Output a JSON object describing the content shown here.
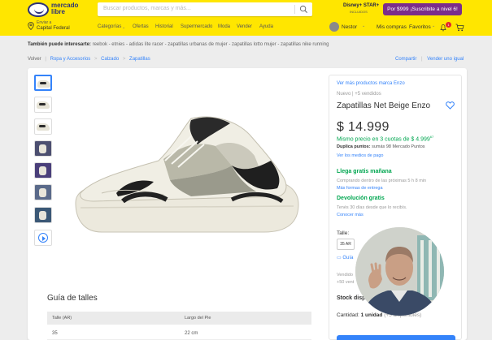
{
  "header": {
    "logo_line1": "mercado",
    "logo_line2": "libre",
    "search_placeholder": "Buscar productos, marcas y más...",
    "promo_brand": "Disney+ STAR+",
    "promo_sub": "INCLUIDOS",
    "promo_button": "Por $999 ¡Suscribite a nivel 6!",
    "location_line1": "Enviar a",
    "location_line2": "Capital Federal",
    "nav": [
      "Categorías",
      "Ofertas",
      "Historial",
      "Supermercado",
      "Moda",
      "Vender",
      "Ayuda"
    ],
    "user_nav": [
      "Nestor",
      "Mis compras",
      "Favoritos"
    ],
    "cart_count": "1"
  },
  "suggestions": {
    "label": "También puede interesarte:",
    "items": "reebok - etnies - adidas lite racer - zapatillas urbanas de mujer - zapatillas lotto mujer - zapatillas nike running"
  },
  "breadcrumb": {
    "back": "Volver",
    "items": [
      "Ropa y Accesorios",
      "Calzado",
      "Zapatillas"
    ],
    "share": "Compartir",
    "sell": "Vender uno igual"
  },
  "product": {
    "brand_link": "Ver más productos marca Enzo",
    "condition": "Nuevo  |  +5 vendidos",
    "title": "Zapatillas Net Beige Enzo",
    "price_symbol": "$",
    "price": "14.999",
    "installments_prefix": "Mismo precio en 3 cuotas de $ 4.999",
    "installments_cents": "67",
    "points_label": "Duplica puntos:",
    "points_text": "sumás",
    "points_value": "98 Mercado Puntos",
    "payment_link": "Ver los medios de pago",
    "shipping_title": "Llega gratis mañana",
    "shipping_sub": "Comprando dentro de las próximas 5 h 8 min",
    "shipping_link": "Más formas de entrega",
    "return_title": "Devolución gratis",
    "return_sub": "Tenés 30 días desde que lo recibís.",
    "return_link": "Conocer más",
    "size_label": "Talle:",
    "size_value": "35 AR",
    "size_guide": "Guía",
    "seller_line1": "Vendido",
    "seller_line2": "+50 vent",
    "stock_label": "Stock disp",
    "quantity_label": "Cantidad:",
    "quantity_value": "1 unidad",
    "quantity_avail": "(+5 disponibles)"
  },
  "size_guide": {
    "title": "Guía de talles",
    "headers": [
      "Talle (AR)",
      "Largo del Pie"
    ],
    "rows": [
      [
        "35",
        "22 cm"
      ]
    ]
  },
  "colors": {
    "yellow": "#ffe600",
    "blue": "#3483fa",
    "green": "#00a650",
    "purple": "#7b2d8b"
  }
}
